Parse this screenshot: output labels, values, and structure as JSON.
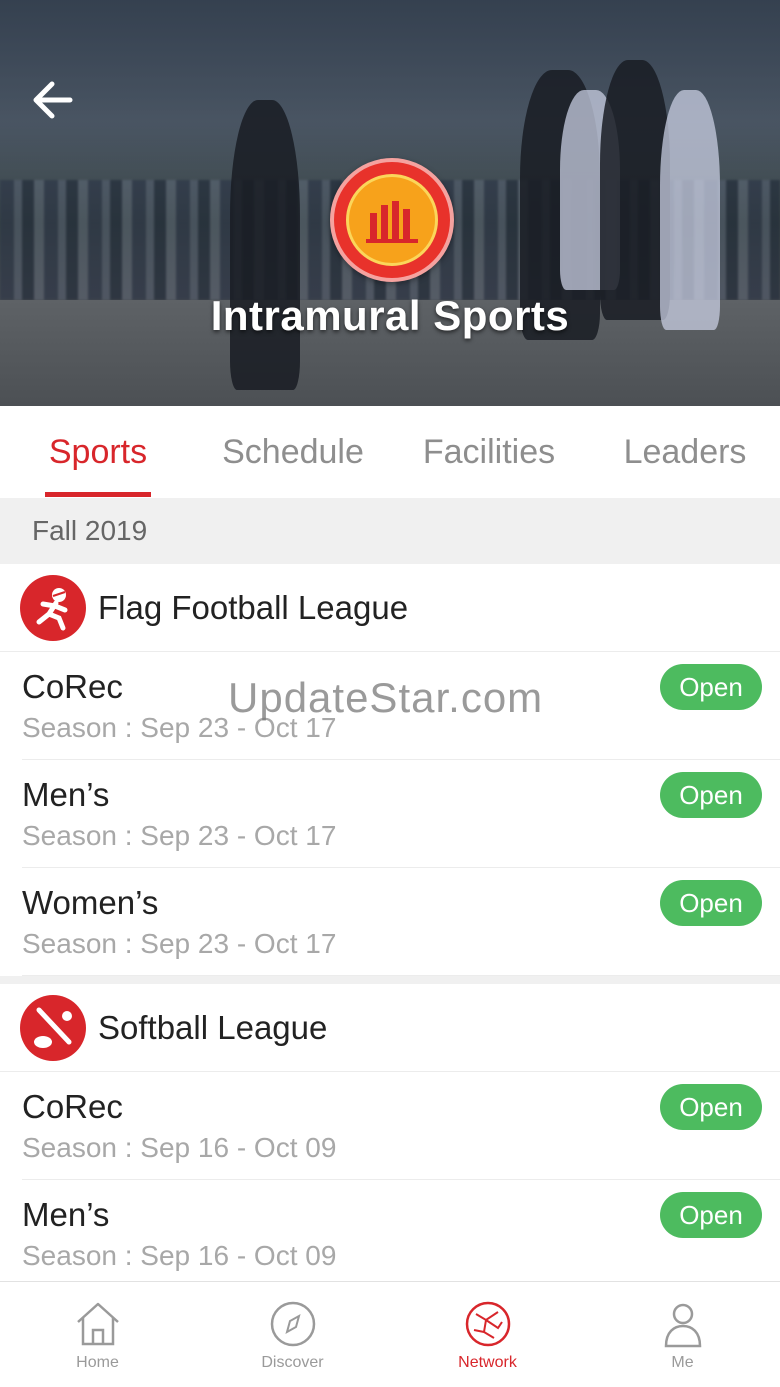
{
  "header": {
    "title": "Intramural Sports",
    "back_icon": "arrow-left-icon",
    "logo": "university-seal"
  },
  "tabs": [
    {
      "label": "Sports",
      "active": true
    },
    {
      "label": "Schedule",
      "active": false
    },
    {
      "label": "Facilities",
      "active": false
    },
    {
      "label": "Leaders",
      "active": false
    }
  ],
  "season_label": "Fall 2019",
  "leagues": [
    {
      "title": "Flag Football League",
      "icon": "flag-football-icon",
      "divisions": [
        {
          "name": "CoRec",
          "season": "Season : Sep 23 - Oct 17",
          "status": "Open"
        },
        {
          "name": "Men’s",
          "season": "Season : Sep 23 - Oct 17",
          "status": "Open"
        },
        {
          "name": "Women’s",
          "season": "Season : Sep 23 - Oct 17",
          "status": "Open"
        }
      ]
    },
    {
      "title": "Softball League",
      "icon": "softball-icon",
      "divisions": [
        {
          "name": "CoRec",
          "season": "Season : Sep 16 - Oct 09",
          "status": "Open"
        },
        {
          "name": "Men’s",
          "season": "Season : Sep 16 - Oct 09",
          "status": "Open"
        }
      ]
    }
  ],
  "watermark": "UpdateStar.com",
  "bottom_nav": [
    {
      "label": "Home",
      "icon": "home-icon",
      "active": false
    },
    {
      "label": "Discover",
      "icon": "compass-icon",
      "active": false
    },
    {
      "label": "Network",
      "icon": "network-icon",
      "active": true
    },
    {
      "label": "Me",
      "icon": "person-icon",
      "active": false
    }
  ],
  "colors": {
    "accent": "#d8262b",
    "open_badge": "#4dbb5f",
    "tab_inactive": "#8e8e8e",
    "season_text": "#a8a8a8"
  }
}
